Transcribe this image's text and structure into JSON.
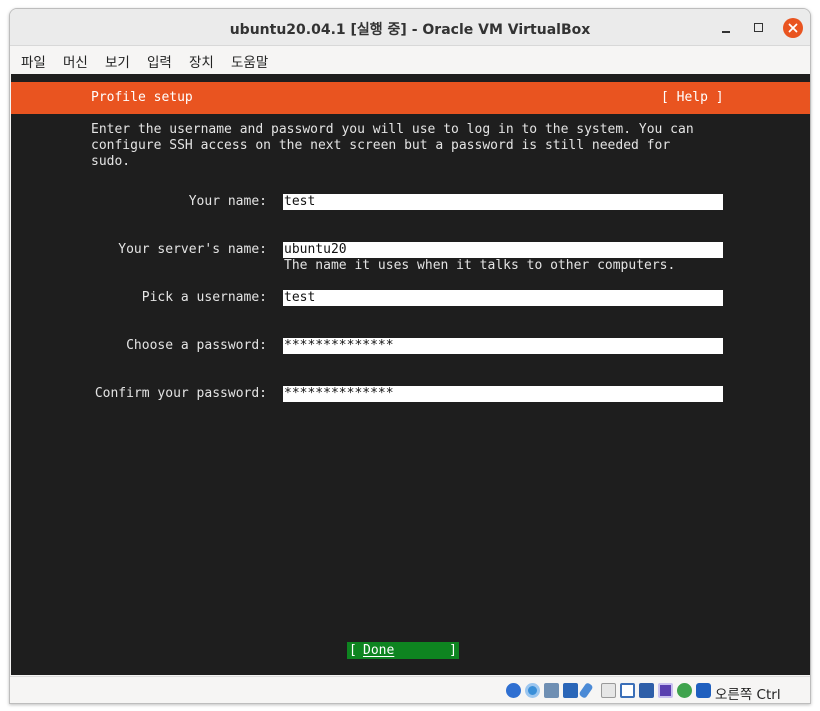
{
  "window": {
    "title": "ubuntu20.04.1 [실행 중] - Oracle VM VirtualBox"
  },
  "menu": [
    "파일",
    "머신",
    "보기",
    "입력",
    "장치",
    "도움말"
  ],
  "installer": {
    "header_title": "Profile setup",
    "help_label": "[ Help ]",
    "intro": "Enter the username and password you will use to log in to the system. You can\nconfigure SSH access on the next screen but a password is still needed for\nsudo.",
    "fields": {
      "name": {
        "label": "Your name:",
        "value": "test"
      },
      "server": {
        "label": "Your server's name:",
        "value": "ubuntu20",
        "hint": "The name it uses when it talks to other computers."
      },
      "username": {
        "label": "Pick a username:",
        "value": "test"
      },
      "password": {
        "label": "Choose a password:",
        "value": "**************"
      },
      "confirm": {
        "label": "Confirm your password:",
        "value": "**************"
      }
    },
    "done_button": {
      "left_bracket": "[",
      "label": "Done",
      "right_bracket": "]"
    }
  },
  "statusbar": {
    "host_key": "오른쪽 Ctrl",
    "icons": [
      "hard-disk-icon",
      "optical-drive-icon",
      "audio-icon",
      "network-icon",
      "usb-icon",
      "shared-folders-icon",
      "display-icon",
      "video-capture-icon",
      "cpu-icon",
      "mouse-integration-icon",
      "keyboard-capture-icon"
    ]
  },
  "colors": {
    "accent": "#e95420",
    "done": "#0e8420",
    "terminal_bg": "#1e1e1e"
  }
}
